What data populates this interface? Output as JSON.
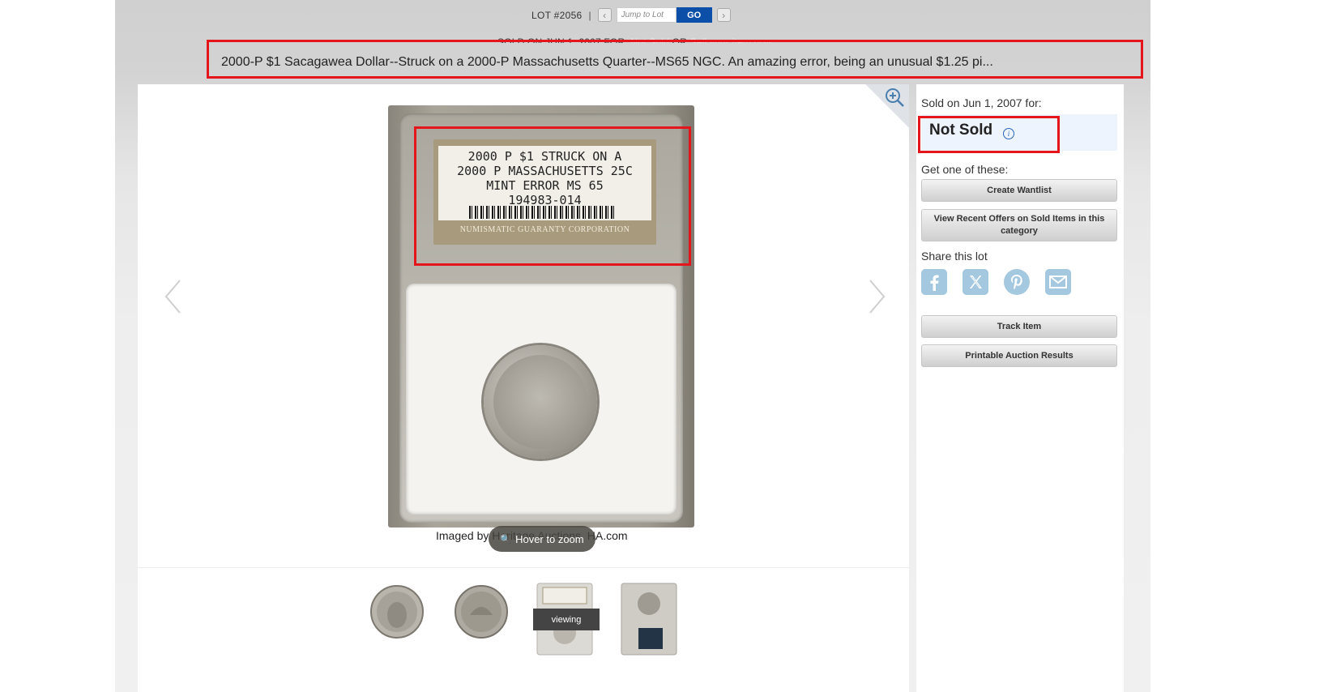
{
  "lot_bar": {
    "lot_number": "LOT #2056",
    "separator": "|",
    "prev_symbol": "‹",
    "next_symbol": "›",
    "jump_placeholder": "Jump to Lot",
    "go_label": "GO"
  },
  "sold_line": {
    "prefix": "SOLD ON JUN 1, 2007 FOR:",
    "link1": "Not Sold",
    "middle": " OR ",
    "link2": "Sell your item now"
  },
  "title": "2000-P $1 Sacagawea Dollar--Struck on a 2000-P Massachusetts Quarter--MS65 NGC. An amazing error, being an unusual $1.25 pi...",
  "main_image": {
    "label_text": "2000 P $1 STRUCK ON A\n2000 P MASSACHUSETTS 25C\nMINT ERROR MS 65\n194983-014",
    "label_footer": "NUMISMATIC GUARANTY CORPORATION",
    "credit": "Imaged by Heritage Auctions, HA.com",
    "hover_label": "Hover to zoom"
  },
  "thumbnails": {
    "viewing_label": "viewing",
    "items": [
      "coin-obverse",
      "coin-reverse",
      "slab-front",
      "slab-back"
    ]
  },
  "sidebar": {
    "sold_on": "Sold on Jun 1, 2007 for:",
    "status": "Not Sold",
    "info_symbol": "i",
    "get_one": "Get one of these:",
    "create_wantlist": "Create Wantlist",
    "view_recent_offers": "View Recent Offers on Sold Items in this category",
    "share_label": "Share this lot",
    "share_icons": [
      "facebook-icon",
      "x-icon",
      "pinterest-icon",
      "email-icon"
    ],
    "track_item": "Track Item",
    "printable_results": "Printable Auction Results"
  },
  "colors": {
    "accent_blue": "#0b4fa8",
    "highlight_red": "#e4161c",
    "share_icon_blue": "#a4c8e0",
    "status_bg": "#edf4fd"
  }
}
